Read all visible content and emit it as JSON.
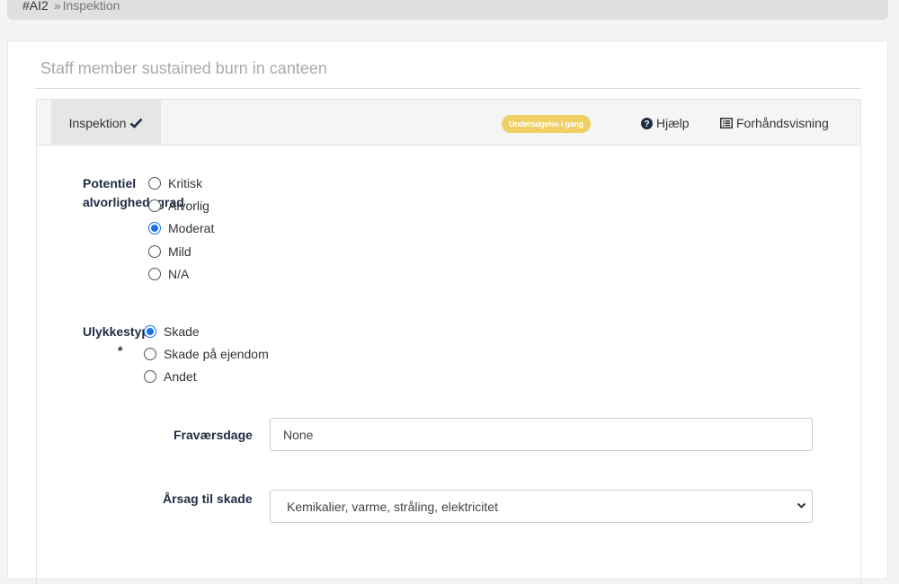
{
  "breadcrumb": {
    "id": "#AI2",
    "separator": "»",
    "current": "Inspektion"
  },
  "title": "Staff member sustained burn in canteen",
  "tabs": {
    "active_label": "Inspektion"
  },
  "status_badge": "Undersøgelse i gang",
  "toolbar": {
    "help_label": "Hjælp",
    "preview_label": "Forhåndsvisning"
  },
  "severity": {
    "label_line1": "Potentiel",
    "label_line2": "alvorlighedsgrad",
    "options": [
      "Kritisk",
      "Alvorlig",
      "Moderat",
      "Mild",
      "N/A"
    ],
    "selected": "Moderat"
  },
  "accident_type": {
    "label": "Ulykkestype",
    "required_mark": "*",
    "options": [
      "Skade",
      "Skade på ejendom",
      "Andet"
    ],
    "selected": "Skade"
  },
  "absence_days": {
    "label": "Fraværsdage",
    "value": "None"
  },
  "injury_cause": {
    "label": "Årsag til skade",
    "value": "Kemikalier, varme, stråling, elektricitet"
  },
  "colors": {
    "badge": "#f0cf63",
    "label": "#1f2a44",
    "radio_selected": "#1a73e8"
  }
}
